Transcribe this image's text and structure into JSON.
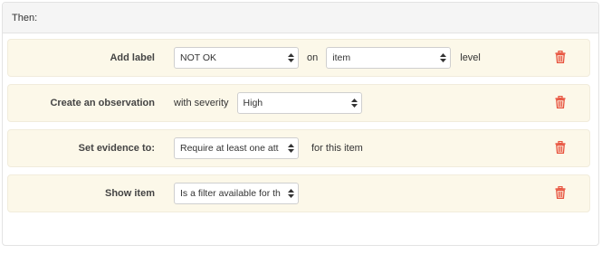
{
  "header": {
    "title": "Then:"
  },
  "rules": [
    {
      "label": "Add label",
      "select1": "NOT OK",
      "connector": "on",
      "select2": "item",
      "suffix": "level"
    },
    {
      "label": "Create an observation",
      "prefix": "with severity",
      "select1": "High"
    },
    {
      "label": "Set evidence to:",
      "select1": "Require at least one att",
      "suffix": "for this item"
    },
    {
      "label": "Show item",
      "select1": "Is a filter available for th"
    }
  ],
  "icons": {
    "delete": "trash-icon"
  },
  "colors": {
    "rule_background": "#fcf8e9",
    "trash": "#e8543f",
    "header_background": "#f5f5f5"
  }
}
